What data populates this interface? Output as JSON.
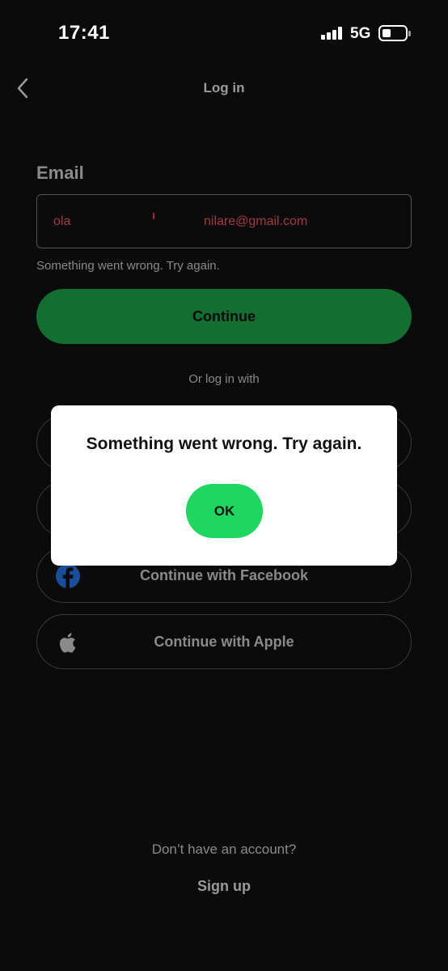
{
  "status_bar": {
    "time": "17:41",
    "network": "5G"
  },
  "nav": {
    "title": "Log in"
  },
  "form": {
    "email_label": "Email",
    "email_value_start": "ola",
    "email_value_end": "nilare@gmail.com",
    "error_text": "Something went wrong. Try again.",
    "continue_label": "Continue"
  },
  "alt_login": {
    "or_text": "Or log in with",
    "facebook_label": "Continue with Facebook",
    "apple_label": "Continue with Apple"
  },
  "dialog": {
    "message": "Something went wrong. Try again.",
    "ok_label": "OK"
  },
  "footer": {
    "no_account_text": "Don’t have an account?",
    "signup_label": "Sign up"
  },
  "colors": {
    "background": "#0b0b0b",
    "continue_button": "#136e31",
    "ok_button": "#1ed760",
    "email_text": "#a23a3f",
    "facebook_blue": "#1877f2"
  },
  "icons": [
    "back-chevron-icon",
    "signal-icon",
    "battery-icon",
    "facebook-icon",
    "apple-icon"
  ]
}
